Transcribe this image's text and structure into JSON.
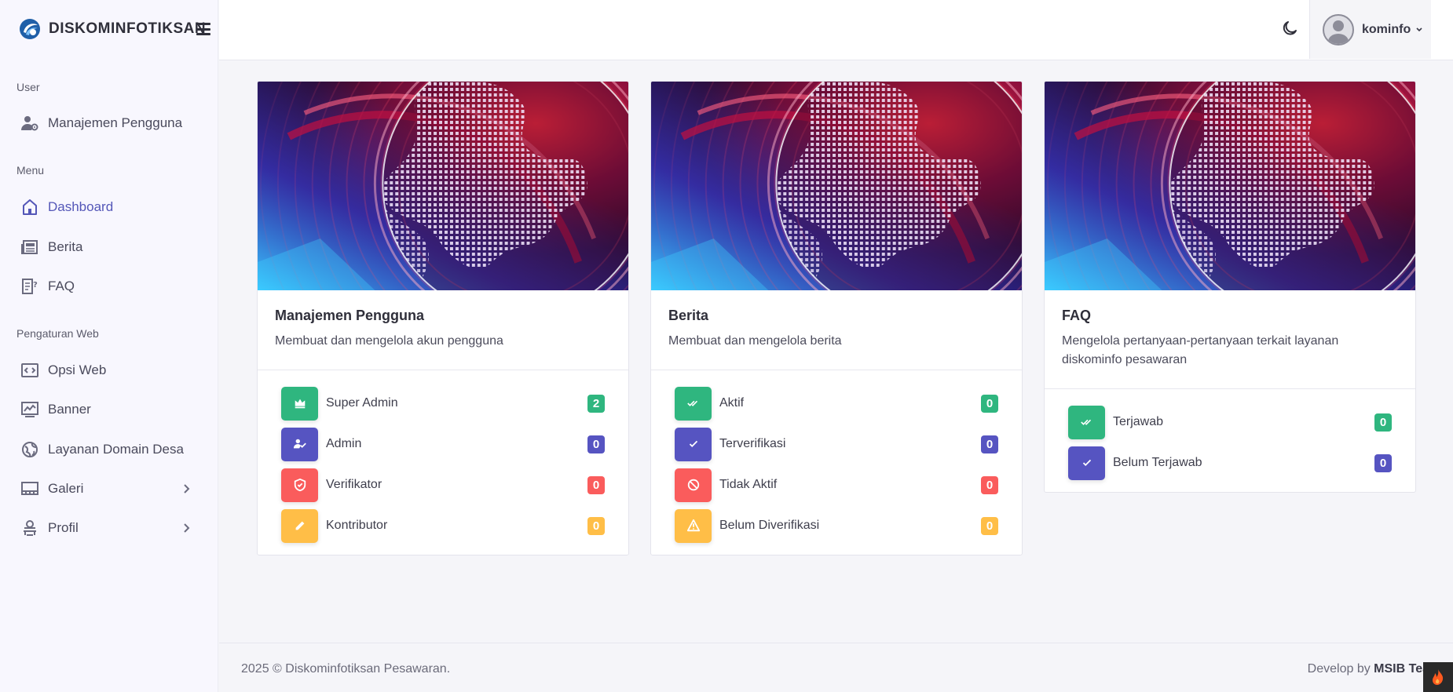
{
  "brand": {
    "name": "DISKOMINFOTIKSAN",
    "logo_icon": "kominfo-logo-icon"
  },
  "sidebar": {
    "sections": [
      {
        "label": "User"
      },
      {
        "label": "Menu"
      },
      {
        "label": "Pengaturan Web"
      }
    ],
    "items": [
      {
        "label": "Manajemen Pengguna",
        "icon": "user-cog-icon"
      },
      {
        "label": "Dashboard",
        "icon": "home-icon",
        "active": true
      },
      {
        "label": "Berita",
        "icon": "newspaper-icon"
      },
      {
        "label": "FAQ",
        "icon": "faq-icon"
      },
      {
        "label": "Opsi Web",
        "icon": "code-window-icon"
      },
      {
        "label": "Banner",
        "icon": "chart-image-icon"
      },
      {
        "label": "Layanan Domain Desa",
        "icon": "globe-icon"
      },
      {
        "label": "Galeri",
        "icon": "gallery-icon"
      },
      {
        "label": "Profil",
        "icon": "profile-icon"
      }
    ]
  },
  "header": {
    "user_name": "kominfo",
    "theme_icon": "moon-icon"
  },
  "cards": [
    {
      "title": "Manajemen Pengguna",
      "desc": "Membuat dan mengelola akun pengguna",
      "stats": [
        {
          "label": "Super Admin",
          "value": "2",
          "icon": "crown-icon",
          "color": "#2fb67f"
        },
        {
          "label": "Admin",
          "value": "0",
          "icon": "user-check-icon",
          "color": "#5654c1"
        },
        {
          "label": "Verifikator",
          "value": "0",
          "icon": "shield-check-icon",
          "color": "#fa5c5c"
        },
        {
          "label": "Kontributor",
          "value": "0",
          "icon": "pencil-icon",
          "color": "#ffbe47"
        }
      ]
    },
    {
      "title": "Berita",
      "desc": "Membuat dan mengelola berita",
      "stats": [
        {
          "label": "Aktif",
          "value": "0",
          "icon": "double-check-icon",
          "color": "#2fb67f"
        },
        {
          "label": "Terverifikasi",
          "value": "0",
          "icon": "check-icon",
          "color": "#5654c1"
        },
        {
          "label": "Tidak Aktif",
          "value": "0",
          "icon": "ban-icon",
          "color": "#fa5c5c"
        },
        {
          "label": "Belum Diverifikasi",
          "value": "0",
          "icon": "warning-icon",
          "color": "#ffbe47"
        }
      ]
    },
    {
      "title": "FAQ",
      "desc": "Mengelola pertanyaan-pertanyaan terkait layanan diskominfo pesawaran",
      "stats": [
        {
          "label": "Terjawab",
          "value": "0",
          "icon": "double-check-icon",
          "color": "#2fb67f"
        },
        {
          "label": "Belum Terjawab",
          "value": "0",
          "icon": "check-icon",
          "color": "#5654c1"
        }
      ]
    }
  ],
  "footer": {
    "copyright": "2025 © Diskominfotiksan Pesawaran.",
    "credit_prefix": "Develop by ",
    "credit_team": "MSIB Tea"
  },
  "colors": {
    "accent": "#5457b8",
    "success": "#2fb67f",
    "primary": "#5654c1",
    "danger": "#fa5c5c",
    "warning": "#ffbe47"
  }
}
